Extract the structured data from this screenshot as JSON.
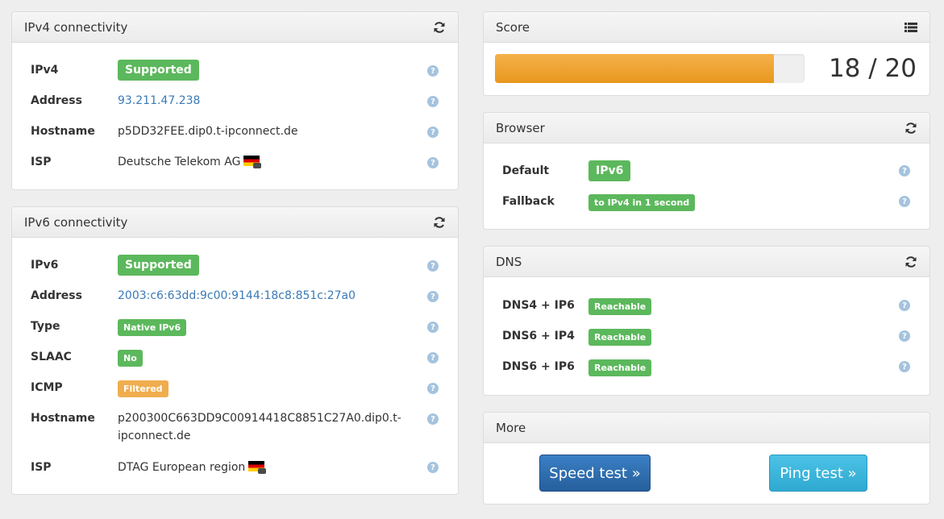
{
  "ipv4": {
    "title": "IPv4 connectivity",
    "rows": [
      {
        "label": "IPv4",
        "value": "Supported"
      },
      {
        "label": "Address",
        "value": "93.211.47.238"
      },
      {
        "label": "Hostname",
        "value": "p5DD32FEE.dip0.t-ipconnect.de"
      },
      {
        "label": "ISP",
        "value": "Deutsche Telekom AG"
      }
    ]
  },
  "ipv6": {
    "title": "IPv6 connectivity",
    "rows": [
      {
        "label": "IPv6",
        "value": "Supported"
      },
      {
        "label": "Address",
        "value": "2003:c6:63dd:9c00:9144:18c8:851c:27a0"
      },
      {
        "label": "Type",
        "value": "Native IPv6"
      },
      {
        "label": "SLAAC",
        "value": "No"
      },
      {
        "label": "ICMP",
        "value": "Filtered"
      },
      {
        "label": "Hostname",
        "value_line1": "p200300C663DD9C00914418C8851C27A0.dip0.t-",
        "value_line2": "ipconnect.de"
      },
      {
        "label": "ISP",
        "value": "DTAG European region"
      }
    ]
  },
  "score": {
    "title": "Score",
    "value": 18,
    "max": 20,
    "text": "18 / 20"
  },
  "browser": {
    "title": "Browser",
    "rows": [
      {
        "label": "Default",
        "value": "IPv6"
      },
      {
        "label": "Fallback",
        "value": "to IPv4 in 1 second"
      }
    ]
  },
  "dns": {
    "title": "DNS",
    "rows": [
      {
        "label": "DNS4 + IP6",
        "value": "Reachable"
      },
      {
        "label": "DNS6 + IP4",
        "value": "Reachable"
      },
      {
        "label": "DNS6 + IP6",
        "value": "Reachable"
      }
    ]
  },
  "more": {
    "title": "More",
    "speed_test": "Speed test »",
    "ping_test": "Ping test »"
  },
  "help_glyph": "?",
  "colors": {
    "success": "#5cb85c",
    "warning": "#f0ad4e",
    "link": "#3a7ab6",
    "progress": "#e8971e",
    "primary": "#2f6fae",
    "info": "#3bb6dd"
  },
  "icons": {
    "refresh": "refresh-icon",
    "list": "list-icon",
    "help": "help-icon",
    "flag": "flag-de-icon"
  }
}
